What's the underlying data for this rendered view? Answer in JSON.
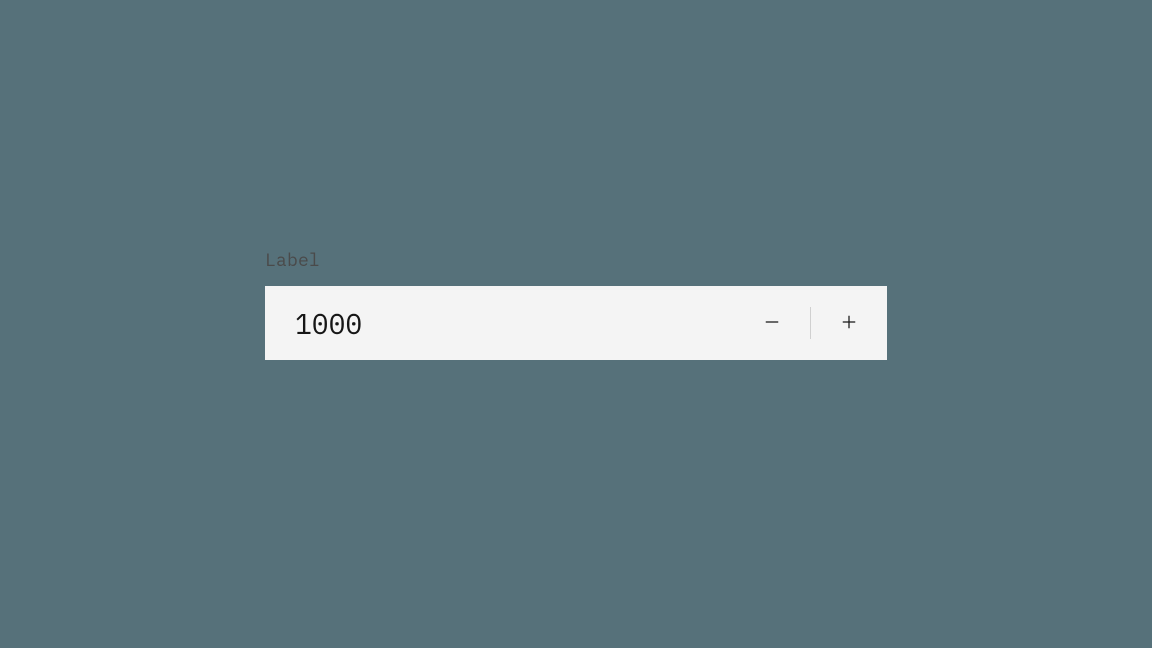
{
  "numberInput": {
    "label": "Label",
    "value": "1000",
    "decrement_icon": "minus",
    "increment_icon": "plus"
  }
}
